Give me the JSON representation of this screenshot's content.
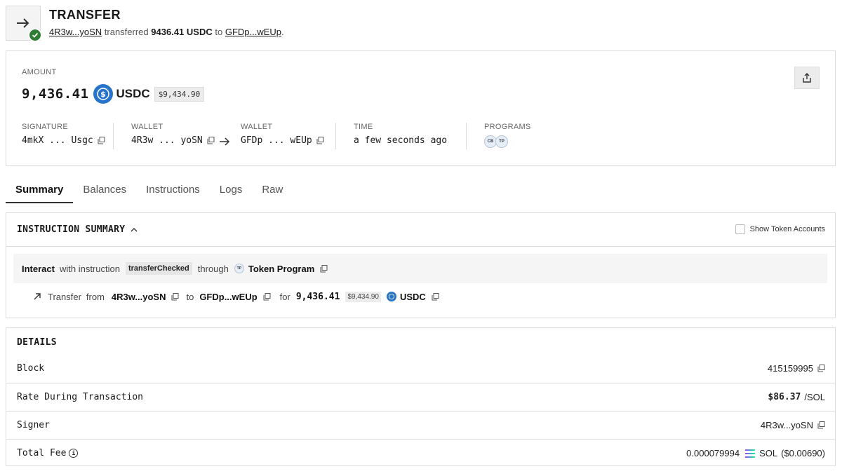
{
  "header": {
    "title": "TRANSFER",
    "from_short": "4R3w...yoSN",
    "verb": "transferred",
    "amount_text": "9436.41 USDC",
    "to_word": "to",
    "to_short": "GFDp...wEUp",
    "period": "."
  },
  "amount": {
    "label": "AMOUNT",
    "value": "9,436.41",
    "symbol": "USDC",
    "usd": "$9,434.90"
  },
  "meta": {
    "signature_label": "SIGNATURE",
    "signature_value": "4mkX ... Usgc",
    "wallet_from_label": "WALLET",
    "wallet_from_value": "4R3w ... yoSN",
    "wallet_to_label": "WALLET",
    "wallet_to_value": "GFDp ... wEUp",
    "time_label": "TIME",
    "time_value": "a few seconds ago",
    "programs_label": "PROGRAMS",
    "programs": [
      "CB",
      "TP"
    ]
  },
  "tabs": [
    "Summary",
    "Balances",
    "Instructions",
    "Logs",
    "Raw"
  ],
  "instruction_summary": {
    "title": "INSTRUCTION SUMMARY",
    "show_token_accounts": "Show Token Accounts",
    "interact_word": "Interact",
    "with_instruction": "with instruction",
    "instruction_name": "transferChecked",
    "through": "through",
    "program_badge": "TP",
    "program_name": "Token Program",
    "transfer_word": "Transfer",
    "from_word": "from",
    "from_addr": "4R3w...yoSN",
    "to_word": "to",
    "to_addr": "GFDp...wEUp",
    "for_word": "for",
    "amount": "9,436.41",
    "usd": "$9,434.90",
    "symbol": "USDC"
  },
  "details": {
    "title": "DETAILS",
    "block_label": "Block",
    "block_value": "415159995",
    "rate_label": "Rate During Transaction",
    "rate_value": "$86.37",
    "rate_unit": "/SOL",
    "signer_label": "Signer",
    "signer_value": "4R3w...yoSN",
    "fee_label": "Total Fee",
    "fee_value": "0.000079994",
    "fee_symbol": "SOL",
    "fee_usd": "($0.00690)"
  },
  "colors": {
    "usdc": "#2775ca",
    "success": "#2e7d32"
  }
}
